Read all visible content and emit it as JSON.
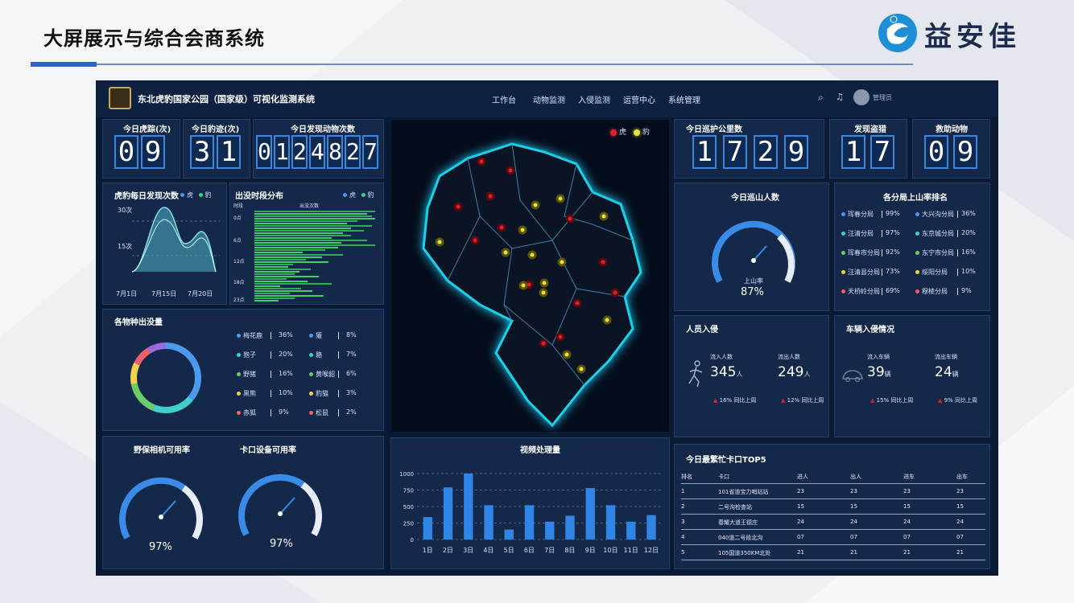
{
  "slide": {
    "title": "大屏展示与综合会商系统",
    "logo_text": "益安佳"
  },
  "nav": {
    "title": "东北虎豹国家公园（国家级）可视化监测系统",
    "items": [
      "工作台",
      "动物监测",
      "入侵监测",
      "运营中心",
      "系统管理"
    ],
    "user": "管理员"
  },
  "counters": {
    "tiger_tracks": {
      "label": "今日虎踪(次)",
      "digits": [
        "0",
        "9"
      ]
    },
    "leopard_tracks": {
      "label": "今日豹迹(次)",
      "digits": [
        "3",
        "1"
      ]
    },
    "animals_found": {
      "label": "今日发现动物次数",
      "digits": [
        "0",
        "1",
        "2",
        "4",
        "8",
        "2",
        "7"
      ]
    },
    "patrol_km": {
      "label": "今日巡护公里数",
      "digits": [
        "1",
        "7",
        "2",
        "9"
      ]
    },
    "poaching": {
      "label": "发现盗猎",
      "digits": [
        "1",
        "7"
      ]
    },
    "rescue": {
      "label": "救助动物",
      "digits": [
        "0",
        "9"
      ]
    }
  },
  "daily_chart": {
    "title": "虎豹每日发现次数",
    "legend": [
      "虎",
      "豹"
    ],
    "y_ticks": [
      "30次",
      "15次"
    ],
    "x_ticks": [
      "7月1日",
      "7月15日",
      "7月20日"
    ]
  },
  "time_dist": {
    "title": "出没时段分布",
    "legend": [
      "虎",
      "豹"
    ],
    "y_label": "时段",
    "x_label": "出没次数",
    "y_ticks": [
      "0点",
      "6点",
      "12点",
      "18点",
      "23点"
    ]
  },
  "species": {
    "title": "各物种出没量",
    "items": [
      {
        "name": "梅花鹿",
        "pct": "36%",
        "color": "#4a9af0"
      },
      {
        "name": "狍子",
        "pct": "20%",
        "color": "#3ecfcf"
      },
      {
        "name": "野猪",
        "pct": "16%",
        "color": "#6acb6a"
      },
      {
        "name": "黑熊",
        "pct": "10%",
        "color": "#f2d24a"
      },
      {
        "name": "赤狐",
        "pct": "9%",
        "color": "#ef5f6f"
      },
      {
        "name": "獾",
        "pct": "8%",
        "color": "#4a9af0"
      },
      {
        "name": "貉",
        "pct": "7%",
        "color": "#3ecfcf"
      },
      {
        "name": "黄喉貂",
        "pct": "6%",
        "color": "#6acb6a"
      },
      {
        "name": "豹猫",
        "pct": "3%",
        "color": "#f2d24a"
      },
      {
        "name": "松鼠",
        "pct": "2%",
        "color": "#ef5f6f"
      }
    ]
  },
  "availability": {
    "camera_title": "野保相机可用率",
    "camera_value": "97%",
    "gate_title": "卡口设备可用率",
    "gate_value": "97%"
  },
  "map": {
    "legend": [
      "虎",
      "豹"
    ]
  },
  "video": {
    "title": "视频处理量",
    "chart_data": {
      "type": "bar",
      "categories": [
        "1日",
        "2日",
        "3日",
        "4日",
        "5日",
        "6日",
        "7日",
        "8日",
        "9日",
        "10日",
        "11日",
        "12日"
      ],
      "values": [
        340,
        790,
        1000,
        520,
        150,
        520,
        270,
        360,
        780,
        520,
        270,
        370
      ],
      "ylim": [
        0,
        1000
      ],
      "y_ticks": [
        "1000",
        "750",
        "500",
        "250",
        "0"
      ]
    }
  },
  "patrol": {
    "title": "今日巡山人数",
    "label": "上山率",
    "value": "87%"
  },
  "branch_rank": {
    "title": "各分局上山率排名",
    "items": [
      {
        "name": "珲春分局",
        "pct": "99%",
        "color": "#4a9af0"
      },
      {
        "name": "汪清分局",
        "pct": "97%",
        "color": "#3ecfcf"
      },
      {
        "name": "珲春市分局",
        "pct": "92%",
        "color": "#6acb6a"
      },
      {
        "name": "汪清县分局",
        "pct": "73%",
        "color": "#f2d24a"
      },
      {
        "name": "天桥岭分局",
        "pct": "69%",
        "color": "#ef5f6f"
      },
      {
        "name": "大兴沟分局",
        "pct": "36%",
        "color": "#4a9af0"
      },
      {
        "name": "东京城分局",
        "pct": "20%",
        "color": "#3ecfcf"
      },
      {
        "name": "东宁市分局",
        "pct": "16%",
        "color": "#6acb6a"
      },
      {
        "name": "绥阳分局",
        "pct": "10%",
        "color": "#f2d24a"
      },
      {
        "name": "穆棱分局",
        "pct": "9%",
        "color": "#ef5f6f"
      }
    ]
  },
  "person_intrusion": {
    "title": "人员入侵",
    "in_label": "流入人数",
    "in_value": "345",
    "in_unit": "人",
    "out_label": "流出人数",
    "out_value": "249",
    "out_unit": "人",
    "in_change": "16%",
    "out_change": "12%",
    "compare": "同比上周"
  },
  "vehicle_intrusion": {
    "title": "车辆入侵情况",
    "in_label": "流入车辆",
    "in_value": "39",
    "in_unit": "辆",
    "out_label": "流出车辆",
    "out_value": "24",
    "out_unit": "辆",
    "in_change": "15%",
    "out_change": "9%",
    "compare": "同比上周"
  },
  "gate_top5": {
    "title": "今日最繁忙卡口TOP5",
    "headers": [
      "排名",
      "卡口",
      "进人",
      "出人",
      "进车",
      "出车"
    ],
    "rows": [
      [
        "1",
        "101省道宝力哨站站",
        "23",
        "23",
        "23",
        "23"
      ],
      [
        "2",
        "二号沟检查站",
        "15",
        "15",
        "15",
        "15"
      ],
      [
        "3",
        "春耀大道王德庄",
        "24",
        "24",
        "24",
        "24"
      ],
      [
        "4",
        "040道二号段北沟",
        "07",
        "07",
        "07",
        "07"
      ],
      [
        "5",
        "105国道350KM北处",
        "21",
        "21",
        "21",
        "21"
      ]
    ]
  },
  "colors": {
    "tiger": "#e0202a",
    "leopard": "#e8e23a",
    "accent": "#3f86d8",
    "panel": "#14294a"
  }
}
